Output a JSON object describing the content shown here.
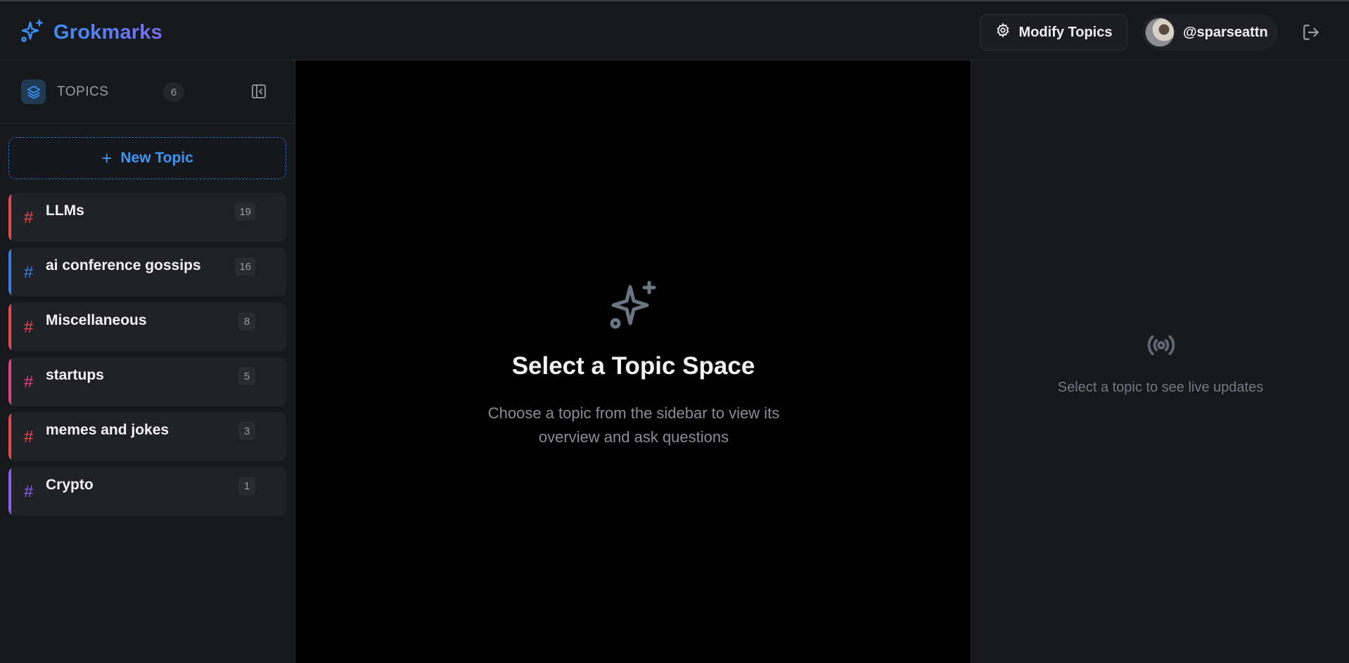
{
  "app": {
    "name": "Grokmarks",
    "brand_gradient": [
      "#3b8ef5",
      "#7b6cf6"
    ],
    "brand_icon": "sparkles-icon"
  },
  "header": {
    "modify_topics_label": "Modify Topics",
    "modify_icon": "gear-icon",
    "username": "@sparseattn",
    "logout_icon": "logout-icon"
  },
  "sidebar": {
    "title": "TOPICS",
    "count": "6",
    "new_topic_label": "New Topic",
    "topics": [
      {
        "name": "LLMs",
        "count": "19",
        "color": "#e5484d"
      },
      {
        "name": "ai conference gossips",
        "count": "16",
        "color": "#3b7be8"
      },
      {
        "name": "Miscellaneous",
        "count": "8",
        "color": "#e5484d"
      },
      {
        "name": "startups",
        "count": "5",
        "color": "#e0408a"
      },
      {
        "name": "memes and jokes",
        "count": "3",
        "color": "#e5484d"
      },
      {
        "name": "Crypto",
        "count": "1",
        "color": "#8e5cf0"
      }
    ]
  },
  "main": {
    "title": "Select a Topic Space",
    "subtitle": "Choose a topic from the sidebar to view its overview and ask questions"
  },
  "right_panel": {
    "message": "Select a topic to see live updates"
  }
}
